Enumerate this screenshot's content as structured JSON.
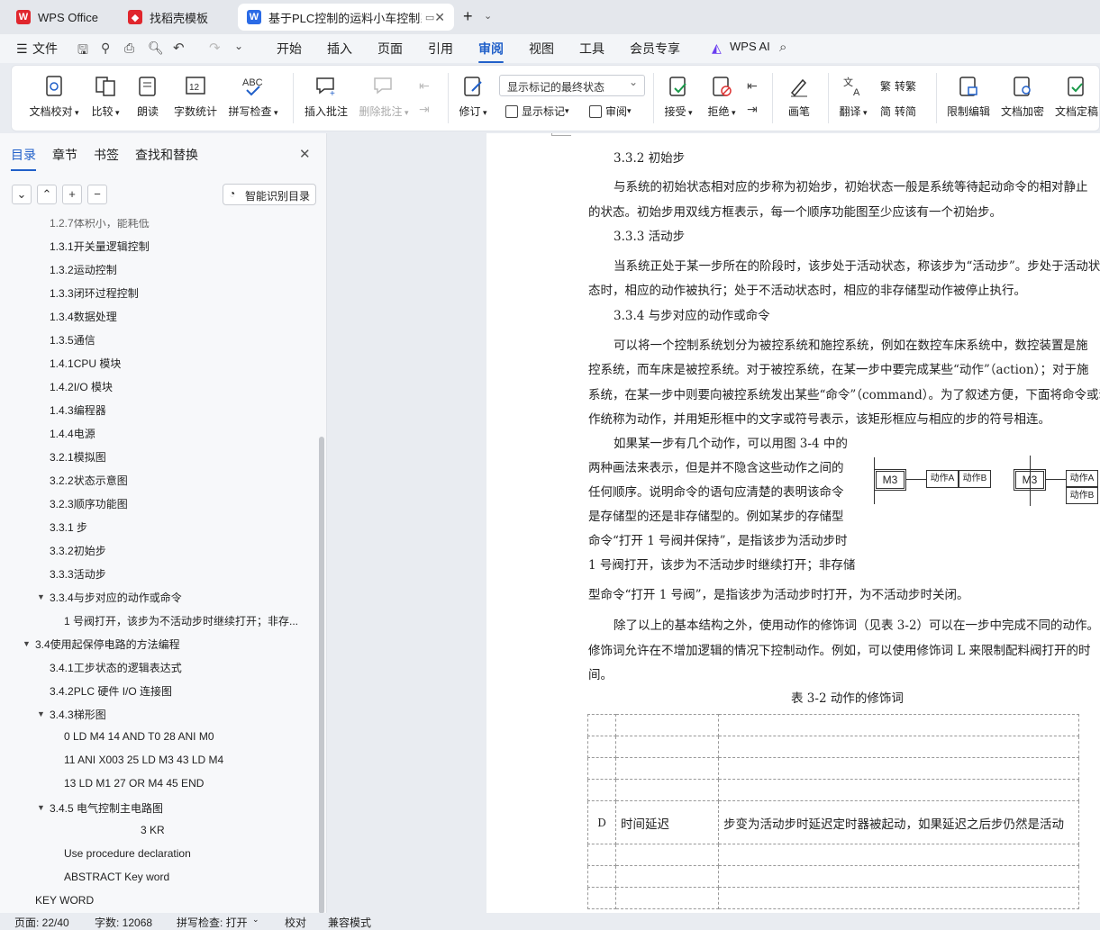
{
  "tabs": [
    {
      "label": "WPS Office"
    },
    {
      "label": "找稻壳模板"
    },
    {
      "label": "基于PLC控制的运料小车控制系"
    }
  ],
  "menu": {
    "file": "文件",
    "items": [
      "开始",
      "插入",
      "页面",
      "引用",
      "审阅",
      "视图",
      "工具",
      "会员专享"
    ],
    "active": "审阅",
    "ai": "WPS AI"
  },
  "ribbon": {
    "doc_check": "文档校对",
    "compare": "比较",
    "read": "朗读",
    "word_count": "字数统计",
    "spell": "拼写检查",
    "insert_comment": "插入批注",
    "delete_comment": "删除批注",
    "revise": "修订",
    "markup_select": "显示标记的最终状态",
    "show_markup": "显示标记",
    "review": "审阅",
    "accept": "接受",
    "reject": "拒绝",
    "pen": "画笔",
    "translate": "翻译",
    "to_trad": "转繁",
    "to_simp": "转简",
    "restrict": "限制编辑",
    "encrypt": "文档加密",
    "finalize": "文档定稿"
  },
  "sidebar": {
    "tabs": [
      "目录",
      "章节",
      "书签",
      "查找和替换"
    ],
    "smart_button": "智能识别目录",
    "items": [
      "1.2.7体积小，能耗低",
      "1.3.1开关量逻辑控制",
      "1.3.2运动控制",
      "1.3.3闭环过程控制",
      "1.3.4数据处理",
      "1.3.5通信",
      "1.4.1CPU 模块",
      "1.4.2I/O 模块",
      "1.4.3编程器",
      "1.4.4电源",
      "3.2.1模拟图",
      "3.2.2状态示意图",
      "3.2.3顺序功能图",
      "3.3.1 步",
      "3.3.2初始步",
      "3.3.3活动步",
      "3.3.4与步对应的动作或命令",
      "1 号阀打开，该步为不活动步时继续打开；非存...",
      "3.4使用起保停电路的方法编程",
      "3.4.1工步状态的逻辑表达式",
      "3.4.2PLC 硬件 I/O 连接图",
      "3.4.3梯形图",
      "0 LD M4 14 AND T0 28 ANI M0",
      "11 ANI X003 25 LD M3 43 LD M4",
      "13 LD M1 27 OR M4 45 END",
      "3.4.5 电气控制主电路图",
      "3 KR",
      "Use procedure declaration",
      "ABSTRACT Key word",
      "KEY WORD"
    ]
  },
  "doc": {
    "lines": [
      "3.3.2 初始步",
      "与系统的初始状态相对应的步称为初始步，初始状态一般是系统等待起动命令的相对静止",
      "的状态。初始步用双线方框表示，每一个顺序功能图至少应该有一个初始步。",
      "3.3.3 活动步",
      "当系统正处于某一步所在的阶段时，该步处于活动状态，称该步为“活动步”。步处于活动状",
      "态时，相应的动作被执行；处于不活动状态时，相应的非存储型动作被停止执行。",
      "3.3.4 与步对应的动作或命令",
      "可以将一个控制系统划分为被控系统和施控系统，例如在数控车床系统中，数控装置是施",
      "控系统，而车床是被控系统。对于被控系统，在某一步中要完成某些“动作”（action）；对于施",
      "系统，在某一步中则要向被控系统发出某些“命令”（command）。为了叙述方便，下面将命令或动",
      "作统称为动作，并用矩形框中的文字或符号表示，该矩形框应与相应的步的符号相连。",
      "如果某一步有几个动作，可以用图 3-4 中的",
      "两种画法来表示，但是并不隐含这些动作之间的",
      "任何顺序。说明命令的语句应清楚的表明该命令",
      "是存储型的还是非存储型的。例如某步的存储型",
      "命令“打开 1 号阀并保持”，是指该步为活动步时",
      "1 号阀打开，该步为不活动步时继续打开；非存储",
      "型命令“打开 1 号阀”，是指该步为活动步时打开，为不活动步时关闭。",
      "除了以上的基本结构之外，使用动作的修饰词（见表 3-2）可以在一步中完成不同的动作。",
      "修饰词允许在不增加逻辑的情况下控制动作。例如，可以使用修饰词 L 来限制配料阀打开的时",
      "间。",
      "表 3-2 动作的修饰词"
    ],
    "diagram": {
      "step": "M3",
      "actionA": "动作A",
      "actionB": "动作B"
    },
    "table_row": {
      "code": "D",
      "name": "时间延迟",
      "desc": "步变为活动步时延迟定时器被起动，如果延迟之后步仍然是活动"
    }
  },
  "status": {
    "page": "页面: 22/40",
    "words": "字数: 12068",
    "spell": "拼写检查: 打开",
    "proof": "校对",
    "compat": "兼容模式"
  }
}
